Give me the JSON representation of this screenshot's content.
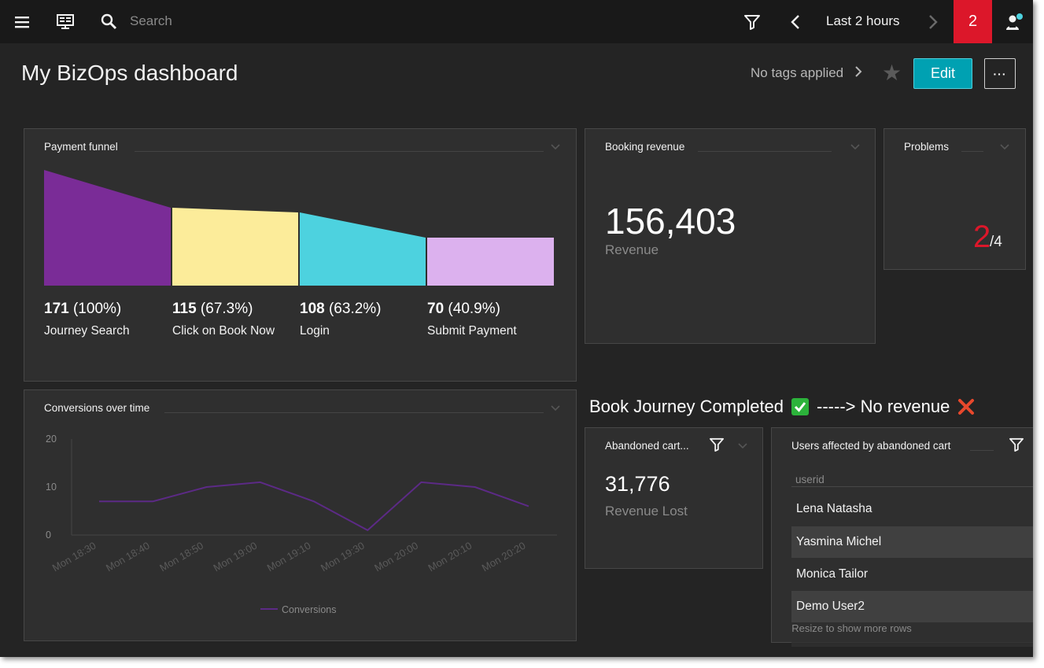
{
  "topbar": {
    "search_placeholder": "Search",
    "timeframe": "Last 2 hours",
    "problem_count": "2"
  },
  "header": {
    "title": "My BizOps dashboard",
    "tags": "No tags applied",
    "edit_label": "Edit",
    "more_label": "···"
  },
  "funnel": {
    "title": "Payment funnel",
    "steps": [
      {
        "count": "171",
        "pct": " (100%)",
        "label": "Journey Search",
        "color": "#7a2c97"
      },
      {
        "count": "115",
        "pct": " (67.3%)",
        "label": "Click on Book Now",
        "color": "#fcec9a"
      },
      {
        "count": "108",
        "pct": " (63.2%)",
        "label": "Login",
        "color": "#4dd2df"
      },
      {
        "count": "70",
        "pct": " (40.9%)",
        "label": "Submit Payment",
        "color": "#dcb1ee"
      }
    ]
  },
  "booking": {
    "title": "Booking revenue",
    "value": "156,403",
    "label": "Revenue"
  },
  "problems": {
    "title": "Problems",
    "value": "2",
    "total": "/4"
  },
  "conversions": {
    "title": "Conversions over time",
    "legend": "Conversions"
  },
  "chart_data": {
    "type": "line",
    "x": [
      "Mon 18:30",
      "Mon 18:40",
      "Mon 18:50",
      "Mon 19:00",
      "Mon 19:10",
      "Mon 19:30",
      "Mon 20:00",
      "Mon 20:10",
      "Mon 20:20"
    ],
    "series": [
      {
        "name": "Conversions",
        "values": [
          7,
          7,
          10,
          11,
          7,
          1,
          11,
          10,
          6
        ],
        "color": "#5c2a86"
      }
    ],
    "yticks": [
      0,
      10,
      20
    ],
    "ylim": [
      0,
      20
    ],
    "legend": "bottom",
    "grid": false
  },
  "headline": {
    "left": "Book Journey Completed",
    "middle": "-----> No revenue"
  },
  "abandoned": {
    "title": "Abandoned cart...",
    "value": "31,776",
    "label": "Revenue Lost"
  },
  "users": {
    "title": "Users affected by abandoned cart",
    "column": "userid",
    "rows": [
      "Lena Natasha",
      "Yasmina Michel",
      "Monica Tailor",
      "Demo User2"
    ],
    "note": "Resize to show more rows"
  }
}
